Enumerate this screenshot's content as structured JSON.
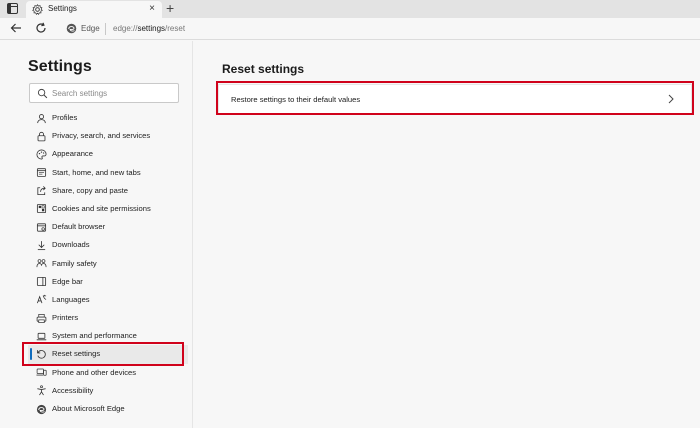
{
  "browser": {
    "tab_title": "Settings",
    "tab_close": "×",
    "new_tab": "+",
    "site_label": "Edge",
    "url_prefix": "edge://",
    "url_path": "settings",
    "url_suffix": "/reset"
  },
  "sidebar": {
    "title": "Settings",
    "search_placeholder": "Search settings",
    "items": [
      {
        "label": "Profiles",
        "icon": "profile-icon"
      },
      {
        "label": "Privacy, search, and services",
        "icon": "lock-icon"
      },
      {
        "label": "Appearance",
        "icon": "palette-icon"
      },
      {
        "label": "Start, home, and new tabs",
        "icon": "window-icon"
      },
      {
        "label": "Share, copy and paste",
        "icon": "share-icon"
      },
      {
        "label": "Cookies and site permissions",
        "icon": "cookie-icon"
      },
      {
        "label": "Default browser",
        "icon": "browser-icon"
      },
      {
        "label": "Downloads",
        "icon": "download-icon"
      },
      {
        "label": "Family safety",
        "icon": "family-icon"
      },
      {
        "label": "Edge bar",
        "icon": "edge-bar-icon"
      },
      {
        "label": "Languages",
        "icon": "language-icon"
      },
      {
        "label": "Printers",
        "icon": "printer-icon"
      },
      {
        "label": "System and performance",
        "icon": "laptop-icon"
      },
      {
        "label": "Reset settings",
        "icon": "reset-icon",
        "active": true
      },
      {
        "label": "Phone and other devices",
        "icon": "phone-icon"
      },
      {
        "label": "Accessibility",
        "icon": "accessibility-icon"
      },
      {
        "label": "About Microsoft Edge",
        "icon": "edge-logo-icon"
      }
    ]
  },
  "main": {
    "title": "Reset settings",
    "restore_label": "Restore settings to their default values"
  },
  "colors": {
    "highlight": "#d0021b",
    "accent": "#0f6cbd"
  }
}
